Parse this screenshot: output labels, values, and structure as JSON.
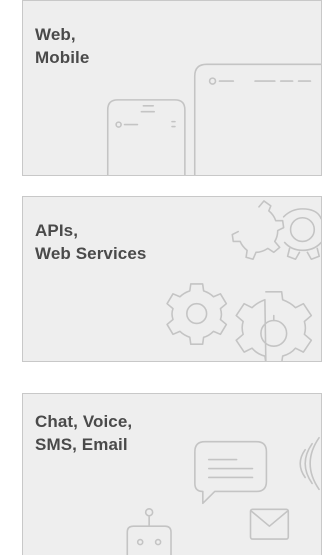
{
  "cards": [
    {
      "id": "web",
      "title": "Web,\nMobile"
    },
    {
      "id": "api",
      "title": "APIs,\nWeb Services"
    },
    {
      "id": "chat",
      "title": "Chat, Voice,\nSMS, Email"
    }
  ],
  "colors": {
    "card_background": "#eeeeee",
    "card_border": "#c8c8c8",
    "title_text": "#4a4a4a",
    "illustration_stroke": "#c4c4c4"
  },
  "icons": {
    "web": [
      "tablet-outline-icon",
      "phone-outline-icon"
    ],
    "api": [
      "gear-outline-icon",
      "gear-pair-outline-icon"
    ],
    "chat": [
      "chat-bubble-icon",
      "sound-waves-icon",
      "envelope-icon",
      "robot-icon"
    ]
  }
}
